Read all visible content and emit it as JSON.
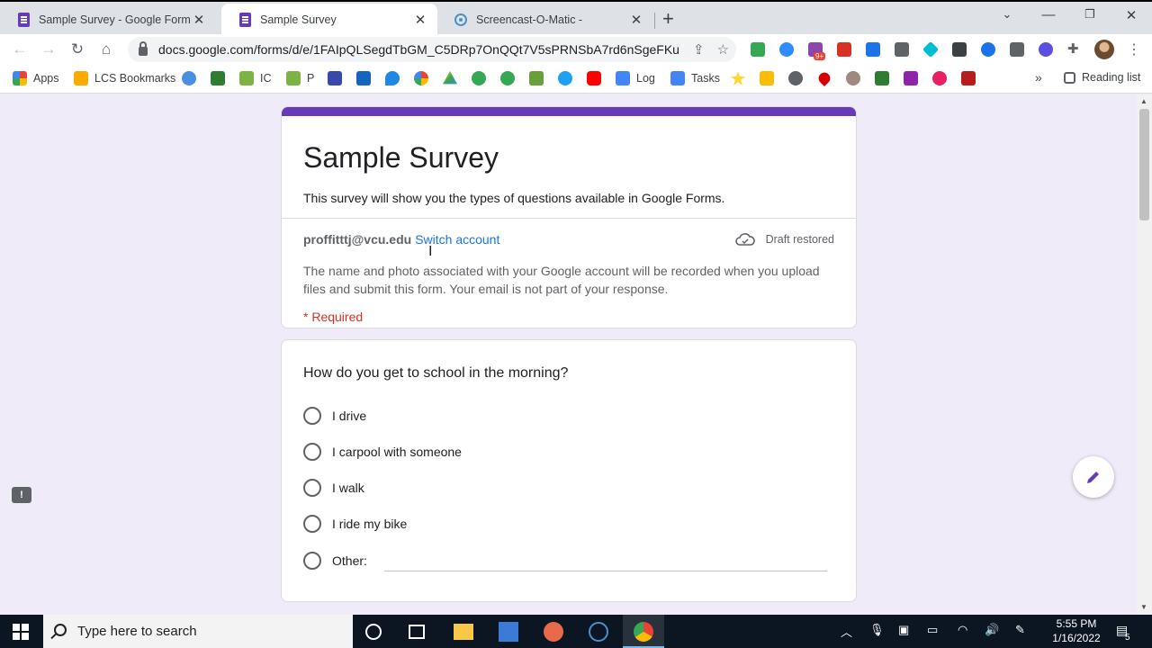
{
  "browser": {
    "tabs": [
      {
        "title": "Sample Survey - Google Forms",
        "icon": "google-forms-icon",
        "active": false
      },
      {
        "title": "Sample Survey",
        "icon": "google-forms-icon",
        "active": true
      },
      {
        "title": "Screencast-O-Matic -",
        "icon": "screencast-icon",
        "active": false
      }
    ],
    "url": "docs.google.com/forms/d/e/1FAIpQLSegdTbGM_C5DRp7OnQQt7V5sPRNSbA7rd6nSgeFKu...",
    "extension_badge": "9+",
    "bookmarks": {
      "apps": "Apps",
      "lcs": "LCS Bookmarks",
      "ic": "IC",
      "p": "P",
      "log": "Log",
      "tasks": "Tasks",
      "overflow": "»",
      "reading_list": "Reading list"
    }
  },
  "form": {
    "title": "Sample Survey",
    "description": "This survey will show you the types of questions available in Google Forms.",
    "account_email": "proffitttj@vcu.edu",
    "switch_account": "Switch account",
    "draft_status": "Draft restored",
    "privacy_notice": "The name and photo associated with your Google account will be recorded when you upload files and submit this form. Your email is not part of your response.",
    "required_note": "* Required",
    "accent_color": "#673ab7",
    "question_1": {
      "title": "How do you get to school in the morning?",
      "options": [
        "I drive",
        "I carpool with someone",
        "I walk",
        "I ride my bike",
        "Other:"
      ]
    }
  },
  "taskbar": {
    "search_placeholder": "Type here to search",
    "time": "5:55 PM",
    "date": "1/16/2022",
    "notification_count": "5"
  }
}
